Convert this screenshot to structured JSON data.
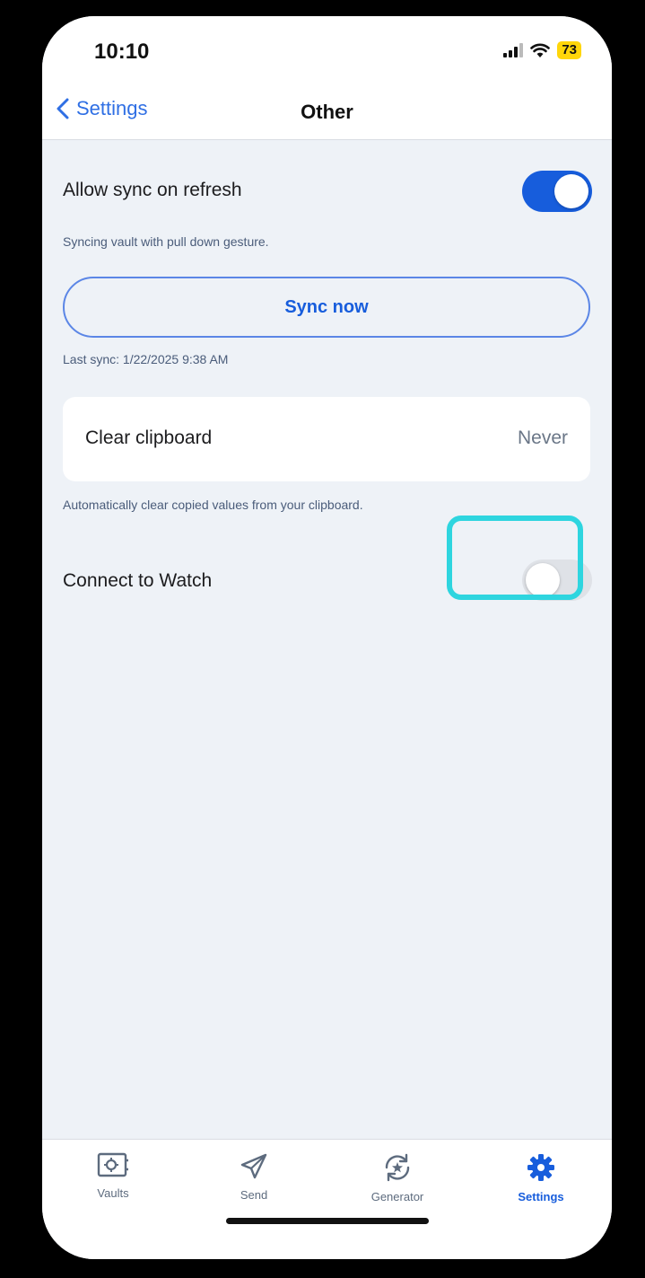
{
  "status_bar": {
    "time": "10:10",
    "battery": "73"
  },
  "nav": {
    "back_label": "Settings",
    "title": "Other"
  },
  "allow_sync": {
    "label": "Allow sync on refresh",
    "helper": "Syncing vault with pull down gesture.",
    "enabled": true
  },
  "sync_button": {
    "label": "Sync now"
  },
  "last_sync": "Last sync: 1/22/2025 9:38 AM",
  "clear_clipboard": {
    "label": "Clear clipboard",
    "value": "Never",
    "helper": "Automatically clear copied values from your clipboard."
  },
  "connect_watch": {
    "label": "Connect to Watch",
    "enabled": false
  },
  "tabs": [
    {
      "label": "Vaults",
      "icon": "vault-icon",
      "active": false
    },
    {
      "label": "Send",
      "icon": "send-icon",
      "active": false
    },
    {
      "label": "Generator",
      "icon": "generator-icon",
      "active": false
    },
    {
      "label": "Settings",
      "icon": "gear-icon",
      "active": true
    }
  ],
  "colors": {
    "accent": "#175ddc",
    "highlight": "#2ed5df",
    "background": "#eef2f7"
  }
}
